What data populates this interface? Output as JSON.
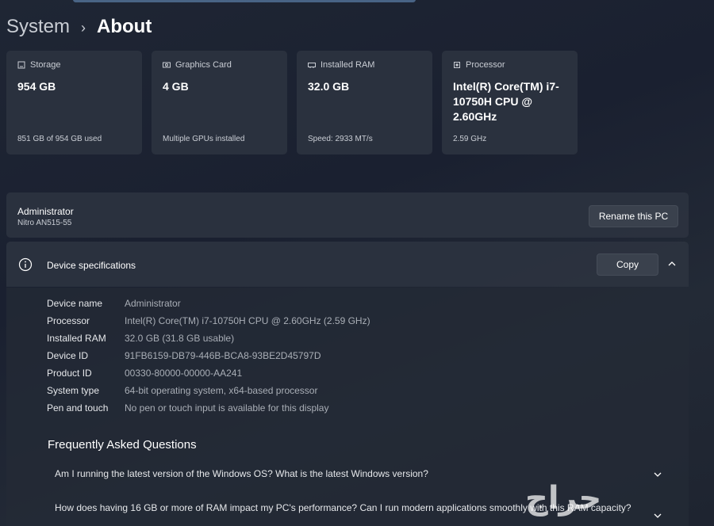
{
  "breadcrumb": {
    "parent": "System",
    "separator": "›",
    "current": "About"
  },
  "cards": [
    {
      "icon": "storage-icon",
      "label": "Storage",
      "value": "954 GB",
      "sub": "851 GB of 954 GB used"
    },
    {
      "icon": "graphics-card-icon",
      "label": "Graphics Card",
      "value": "4 GB",
      "sub": "Multiple GPUs installed"
    },
    {
      "icon": "ram-icon",
      "label": "Installed RAM",
      "value": "32.0 GB",
      "sub": "Speed: 2933 MT/s"
    },
    {
      "icon": "processor-icon",
      "label": "Processor",
      "value": "Intel(R) Core(TM) i7-10750H CPU @ 2.60GHz",
      "sub": "2.59 GHz"
    }
  ],
  "pc": {
    "name": "Administrator",
    "model": "Nitro AN515-55",
    "rename_label": "Rename this PC"
  },
  "specs": {
    "title": "Device specifications",
    "copy_label": "Copy",
    "rows": [
      {
        "label": "Device name",
        "value": "Administrator"
      },
      {
        "label": "Processor",
        "value": "Intel(R) Core(TM) i7-10750H CPU @ 2.60GHz (2.59 GHz)"
      },
      {
        "label": "Installed RAM",
        "value": "32.0 GB (31.8 GB usable)"
      },
      {
        "label": "Device ID",
        "value": "91FB6159-DB79-446B-BCA8-93BE2D45797D"
      },
      {
        "label": "Product ID",
        "value": "00330-80000-00000-AA241"
      },
      {
        "label": "System type",
        "value": "64-bit operating system, x64-based processor"
      },
      {
        "label": "Pen and touch",
        "value": "No pen or touch input is available for this display"
      }
    ]
  },
  "faq": {
    "title": "Frequently Asked Questions",
    "items": [
      "Am I running the latest version of the Windows OS? What is the latest Windows version?",
      "How does having 16 GB or more of RAM impact my PC's performance? Can I run modern applications smoothly with this RAM capacity?"
    ]
  },
  "watermark": "حراج",
  "colors": {
    "card_bg": "#2c3340",
    "text_secondary": "#c9cdd4",
    "value_secondary": "#a9aeb6",
    "button_bg": "#3a414d"
  }
}
